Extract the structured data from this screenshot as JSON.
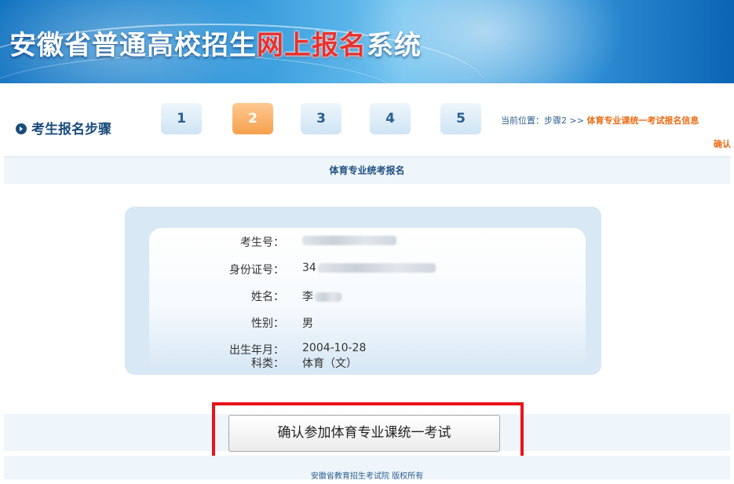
{
  "header": {
    "title_pre": "安徽省普通高校招生",
    "title_highlight": "网上报名",
    "title_post": "系统"
  },
  "steps": {
    "label": "考生报名步骤",
    "items": [
      "1",
      "2",
      "3",
      "4",
      "5"
    ],
    "active": "2"
  },
  "breadcrumb": {
    "prefix": "当前位置：步骤2 >> ",
    "current": "体育专业课统一考试报名信息",
    "current_tail": "确认"
  },
  "section": {
    "title": "体育专业统考报名"
  },
  "info": {
    "fields": [
      {
        "label": "考生号：",
        "value": ""
      },
      {
        "label": "身份证号：",
        "value": "34"
      },
      {
        "label": "姓名：",
        "value": "李"
      },
      {
        "label": "性别：",
        "value": "男"
      },
      {
        "label": "出生年月：",
        "value": "2004-10-28"
      },
      {
        "label": "科类：",
        "value": "体育（文）"
      }
    ]
  },
  "actions": {
    "confirm_label": "确认参加体育专业课统一考试"
  },
  "footer": {
    "copyright": "安徽省教育招生考试院 版权所有"
  },
  "colors": {
    "accent": "#f5a04d",
    "highlight": "#e8141c",
    "brand": "#1b4c7d"
  }
}
